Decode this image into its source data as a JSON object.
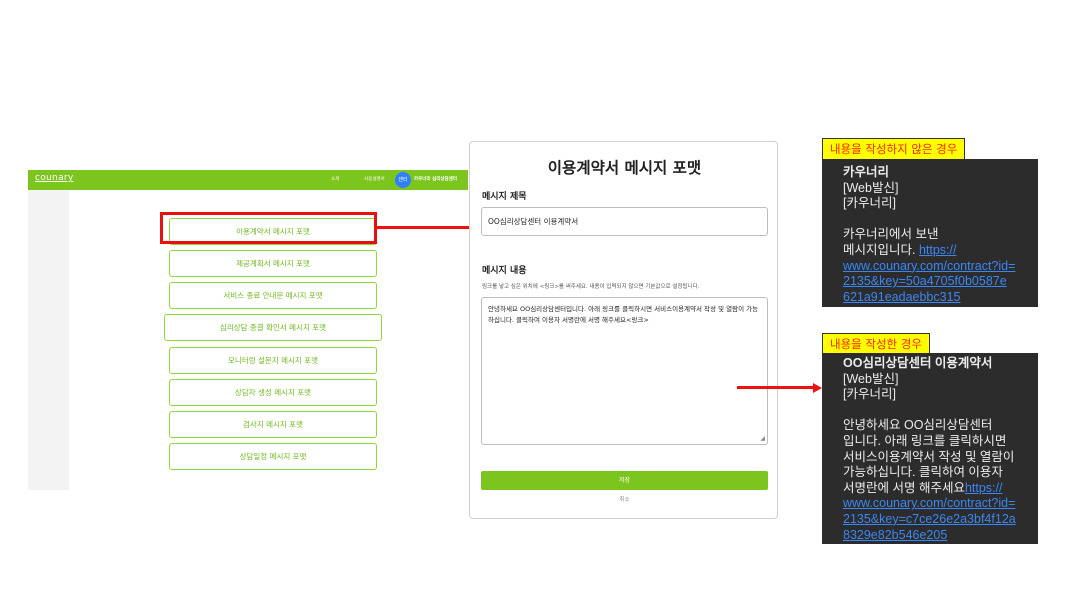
{
  "app": {
    "logo": "counary",
    "nav": {
      "about": "소개",
      "guide": "사용설명서",
      "center_badge": "센터",
      "center_name": "카우너리 심리상담센터"
    },
    "format_buttons": [
      "이용계약서 메시지 포맷",
      "제공계획서 메시지 포맷",
      "서비스 종료 안내문 메시지 포맷",
      "심리상담 종결 확인서 메시지 포맷",
      "모니터링 설문지 메시지 포맷",
      "상담자 생성 메시지 포맷",
      "검사지 메시지 포맷",
      "상담일정 메시지 포맷"
    ],
    "accent_color": "#7cc51f"
  },
  "form": {
    "title": "이용계약서 메시지 포맷",
    "subject_label": "메시지 제목",
    "subject_value": "OO심리상담센터 이용계약서",
    "content_label": "메시지 내용",
    "content_hint": "링크를 넣고 싶은 위치에 <링크>를 써주세요. 내용이 입력되지 않으면 기본값으로 설정됩니다.",
    "content_value": "안녕하세요 OO심리상담센터입니다. 아래 링크를 클릭하시면 서비스이용계약서 작성 및 열람이 가능하십니다. 클릭하여 이용자 서명란에 서명 해주세요<링크>",
    "save_label": "저장",
    "cancel_label": "취소"
  },
  "preview_empty": {
    "label": "내용을 작성하지 않은 경우",
    "sender": "카우너리",
    "tag": "[Web발신]",
    "brand": "[카우너리]",
    "body_line1": "카우너리에서 보낸",
    "body_line2": "메시지입니다. ",
    "link_part1": "https://",
    "link_part2": "www.counary.com/contract?id=",
    "link_part3": "2135&key=50a4705f0b0587e",
    "link_part4": "621a91eadaebbc315"
  },
  "preview_filled": {
    "label": "내용을 작성한 경우",
    "title": "OO심리상담센터 이용계약서",
    "tag": "[Web발신]",
    "brand": "[카우너리]",
    "body_line1": "안녕하세요 OO심리상담센터",
    "body_line2": "입니다. 아래 링크를 클릭하시면",
    "body_line3": "서비스이용계약서 작성 및 열람이",
    "body_line4": "가능하십니다. 클릭하여 이용자",
    "body_line5": "서명란에 서명 해주세요",
    "link_part1": "https://",
    "link_part2": "www.counary.com/contract?id=",
    "link_part3": "2135&key=c7ce26e2a3bf4f12a",
    "link_part4": "8329e82b546e205"
  },
  "colors": {
    "highlight": "#e8100e",
    "label_bg": "#ffff00",
    "label_text": "#ff2200",
    "link": "#3b87f5"
  }
}
